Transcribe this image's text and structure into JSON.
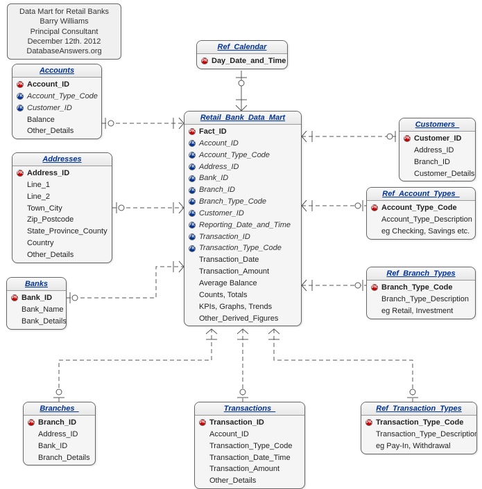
{
  "info": {
    "line1": "Data Mart for Retail Banks",
    "line2": "Barry Williams",
    "line3": "Principal Consultant",
    "line4": "December 12th. 2012",
    "line5": "DatabaseAnswers.org"
  },
  "entities": {
    "accounts": {
      "title": "Accounts",
      "rows": [
        {
          "key": "PK",
          "label": "Account_ID",
          "bold": true
        },
        {
          "key": "FK",
          "label": "Account_Type_Code",
          "italic": true
        },
        {
          "key": "FK",
          "label": "Customer_ID",
          "italic": true
        },
        {
          "key": "",
          "label": "Balance"
        },
        {
          "key": "",
          "label": "Other_Details"
        }
      ]
    },
    "addresses": {
      "title": "Addresses",
      "rows": [
        {
          "key": "PK",
          "label": "Address_ID",
          "bold": true
        },
        {
          "key": "",
          "label": "Line_1"
        },
        {
          "key": "",
          "label": "Line_2"
        },
        {
          "key": "",
          "label": "Town_City"
        },
        {
          "key": "",
          "label": "Zip_Postcode"
        },
        {
          "key": "",
          "label": "State_Province_County"
        },
        {
          "key": "",
          "label": "Country"
        },
        {
          "key": "",
          "label": "Other_Details"
        }
      ]
    },
    "banks": {
      "title": "Banks",
      "rows": [
        {
          "key": "PK",
          "label": "Bank_ID",
          "bold": true
        },
        {
          "key": "",
          "label": "Bank_Name"
        },
        {
          "key": "",
          "label": "Bank_Details"
        }
      ]
    },
    "ref_calendar": {
      "title": "Ref_Calendar",
      "rows": [
        {
          "key": "PK",
          "label": "Day_Date_and_Time",
          "bold": true
        }
      ]
    },
    "retail_bank_data_mart": {
      "title": "Retail_Bank_Data_Mart",
      "rows": [
        {
          "key": "PK",
          "label": "Fact_ID",
          "bold": true
        },
        {
          "key": "FK",
          "label": "Account_ID",
          "italic": true
        },
        {
          "key": "FK",
          "label": "Account_Type_Code",
          "italic": true
        },
        {
          "key": "FK",
          "label": "Address_ID",
          "italic": true
        },
        {
          "key": "FK",
          "label": "Bank_ID",
          "italic": true
        },
        {
          "key": "FK",
          "label": "Branch_ID",
          "italic": true
        },
        {
          "key": "FK",
          "label": "Branch_Type_Code",
          "italic": true
        },
        {
          "key": "FK",
          "label": "Customer_ID",
          "italic": true
        },
        {
          "key": "FK",
          "label": "Reporting_Date_and_Time",
          "italic": true
        },
        {
          "key": "FK",
          "label": "Transaction_ID",
          "italic": true
        },
        {
          "key": "FK",
          "label": "Transaction_Type_Code",
          "italic": true
        },
        {
          "key": "",
          "label": "Transaction_Date"
        },
        {
          "key": "",
          "label": "Transaction_Amount"
        },
        {
          "key": "",
          "label": "Average Balance"
        },
        {
          "key": "",
          "label": "Counts, Totals"
        },
        {
          "key": "",
          "label": "KPIs, Graphs, Trends"
        },
        {
          "key": "",
          "label": "Other_Derived_Figures"
        }
      ]
    },
    "customers": {
      "title": "Customers_",
      "rows": [
        {
          "key": "PK",
          "label": "Customer_ID",
          "bold": true
        },
        {
          "key": "",
          "label": "Address_ID"
        },
        {
          "key": "",
          "label": "Branch_ID"
        },
        {
          "key": "",
          "label": "Customer_Details"
        }
      ]
    },
    "ref_account_types": {
      "title": "Ref_Account_Types_",
      "rows": [
        {
          "key": "PK",
          "label": "Account_Type_Code",
          "bold": true
        },
        {
          "key": "",
          "label": "Account_Type_Description"
        },
        {
          "key": "",
          "label": "eg Checking, Savings etc."
        }
      ]
    },
    "ref_branch_types": {
      "title": "Ref_Branch_Types",
      "rows": [
        {
          "key": "PK",
          "label": "Branch_Type_Code",
          "bold": true
        },
        {
          "key": "",
          "label": "Branch_Type_Description"
        },
        {
          "key": "",
          "label": "eg Retail, Investment"
        }
      ]
    },
    "branches": {
      "title": "Branches_",
      "rows": [
        {
          "key": "PK",
          "label": "Branch_ID",
          "bold": true
        },
        {
          "key": "",
          "label": "Address_ID"
        },
        {
          "key": "",
          "label": "Bank_ID"
        },
        {
          "key": "",
          "label": "Branch_Details"
        }
      ]
    },
    "transactions": {
      "title": "Transactions_",
      "rows": [
        {
          "key": "PK",
          "label": "Transaction_ID",
          "bold": true
        },
        {
          "key": "",
          "label": "Account_ID"
        },
        {
          "key": "",
          "label": "Transaction_Type_Code"
        },
        {
          "key": "",
          "label": "Transaction_Date_Time"
        },
        {
          "key": "",
          "label": "Transaction_Amount"
        },
        {
          "key": "",
          "label": "Other_Details"
        }
      ]
    },
    "ref_transaction_types": {
      "title": "Ref_Transaction_Types",
      "rows": [
        {
          "key": "PK",
          "label": "Transaction_Type_Code",
          "bold": true
        },
        {
          "key": "",
          "label": "Transaction_Type_Description"
        },
        {
          "key": "",
          "label": "eg Pay-In, Withdrawal"
        }
      ]
    }
  }
}
